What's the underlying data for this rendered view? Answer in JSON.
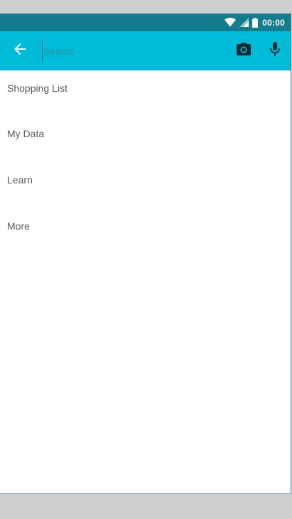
{
  "status_bar": {
    "time": "00:00",
    "icons": [
      "wifi-icon",
      "signal-icon",
      "battery-icon"
    ]
  },
  "search_bar": {
    "placeholder": "Search",
    "value": "",
    "back_icon": "arrow-left-icon",
    "camera_icon": "camera-icon",
    "mic_icon": "microphone-icon"
  },
  "menu": {
    "items": [
      {
        "label": "Shopping List"
      },
      {
        "label": "My Data"
      },
      {
        "label": "Learn"
      },
      {
        "label": "More"
      }
    ]
  },
  "colors": {
    "status_bar": "#127d8c",
    "toolbar": "#00bcd9",
    "background": "#cfcfcf",
    "text": "#5a5a5a"
  }
}
